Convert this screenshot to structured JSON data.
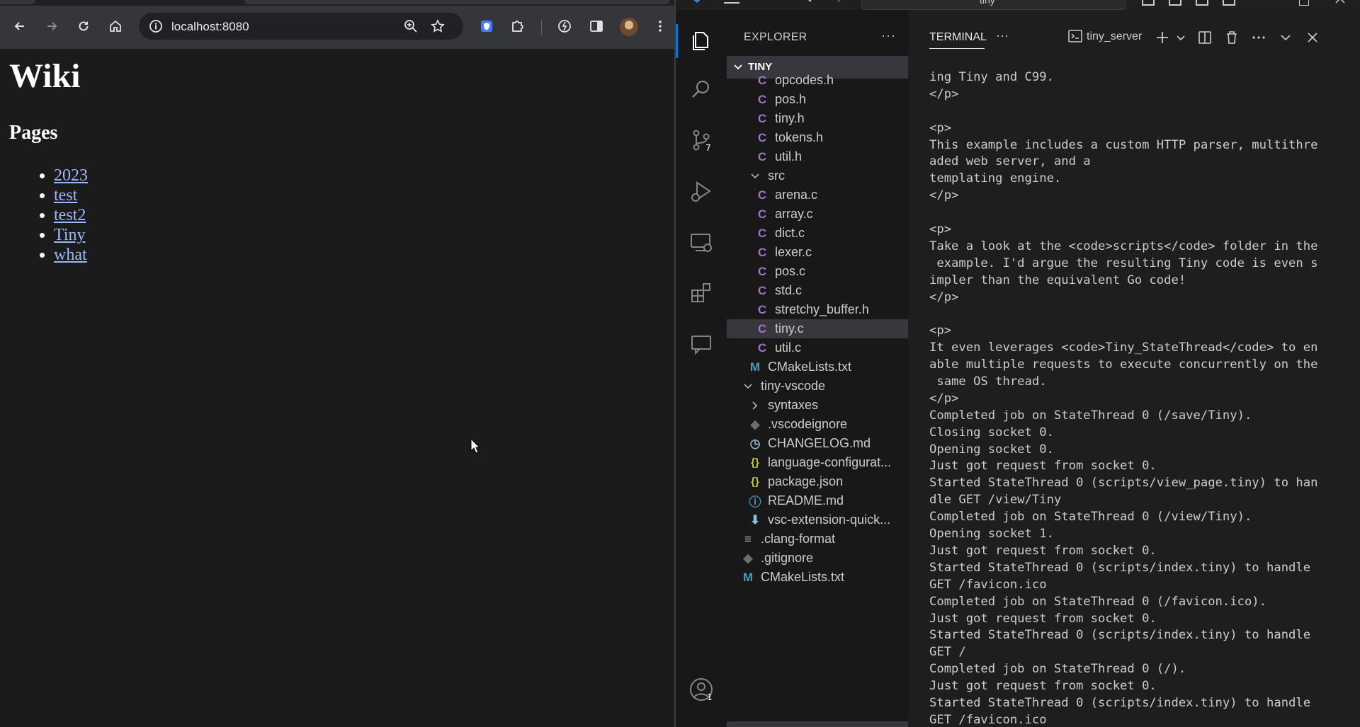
{
  "browser": {
    "url": "localhost:8080",
    "page": {
      "title": "Wiki",
      "subtitle": "Pages",
      "links": [
        "2023",
        "test",
        "test2",
        "Tiny",
        "what"
      ]
    }
  },
  "vscode": {
    "command_center": "tiny",
    "source_control_badge": "7",
    "accounts_badge": "1",
    "explorer": {
      "title": "EXPLORER",
      "more": "···",
      "section": "TINY",
      "items": [
        {
          "label": "opcodes.h",
          "icon": "C"
        },
        {
          "label": "pos.h",
          "icon": "C"
        },
        {
          "label": "tiny.h",
          "icon": "C"
        },
        {
          "label": "tokens.h",
          "icon": "C"
        },
        {
          "label": "util.h",
          "icon": "C"
        },
        {
          "label": "src",
          "icon": "chevron-down"
        },
        {
          "label": "arena.c",
          "icon": "C"
        },
        {
          "label": "array.c",
          "icon": "C"
        },
        {
          "label": "dict.c",
          "icon": "C"
        },
        {
          "label": "lexer.c",
          "icon": "C"
        },
        {
          "label": "pos.c",
          "icon": "C"
        },
        {
          "label": "std.c",
          "icon": "C"
        },
        {
          "label": "stretchy_buffer.h",
          "icon": "C"
        },
        {
          "label": "tiny.c",
          "icon": "C",
          "selected": true
        },
        {
          "label": "util.c",
          "icon": "C"
        },
        {
          "label": "CMakeLists.txt",
          "icon": "M"
        },
        {
          "label": "tiny-vscode",
          "icon": "chevron-down"
        },
        {
          "label": "syntaxes",
          "icon": "chevron-right"
        },
        {
          "label": ".vscodeignore",
          "icon": "git"
        },
        {
          "label": "CHANGELOG.md",
          "icon": "clock"
        },
        {
          "label": "language-configurat...",
          "icon": "{}"
        },
        {
          "label": "package.json",
          "icon": "{}"
        },
        {
          "label": "README.md",
          "icon": "info"
        },
        {
          "label": "vsc-extension-quick...",
          "icon": "download"
        },
        {
          "label": ".clang-format",
          "icon": "lines"
        },
        {
          "label": ".gitignore",
          "icon": "git"
        },
        {
          "label": "CMakeLists.txt",
          "icon": "M"
        }
      ]
    },
    "terminal": {
      "tab_label": "TERMINAL",
      "more": "···",
      "shell": "tiny_server",
      "lines": [
        "ing Tiny and C99.",
        "</p>",
        "",
        "<p>",
        "This example includes a custom HTTP parser, multithre",
        "aded web server, and a",
        "templating engine.",
        "</p>",
        "",
        "<p>",
        "Take a look at the <code>scripts</code> folder in the",
        " example. I'd argue the resulting Tiny code is even s",
        "impler than the equivalent Go code!",
        "</p>",
        "",
        "<p>",
        "It even leverages <code>Tiny_StateThread</code> to en",
        "able multiple requests to execute concurrently on the",
        " same OS thread.",
        "</p>",
        "Completed job on StateThread 0 (/save/Tiny).",
        "Closing socket 0.",
        "Opening socket 0.",
        "Just got request from socket 0.",
        "Started StateThread 0 (scripts/view_page.tiny) to han",
        "dle GET /view/Tiny",
        "Completed job on StateThread 0 (/view/Tiny).",
        "Opening socket 1.",
        "Just got request from socket 0.",
        "Started StateThread 0 (scripts/index.tiny) to handle",
        "GET /favicon.ico",
        "Completed job on StateThread 0 (/favicon.ico).",
        "Just got request from socket 0.",
        "Started StateThread 0 (scripts/index.tiny) to handle",
        "GET /",
        "Completed job on StateThread 0 (/).",
        "Just got request from socket 0.",
        "Started StateThread 0 (scripts/index.tiny) to handle",
        "GET /favicon.ico"
      ]
    }
  },
  "colors": {
    "accent": "#0078d4",
    "link": "#9eb8ff",
    "c_icon": "#a074c4",
    "selection": "#37373d"
  }
}
